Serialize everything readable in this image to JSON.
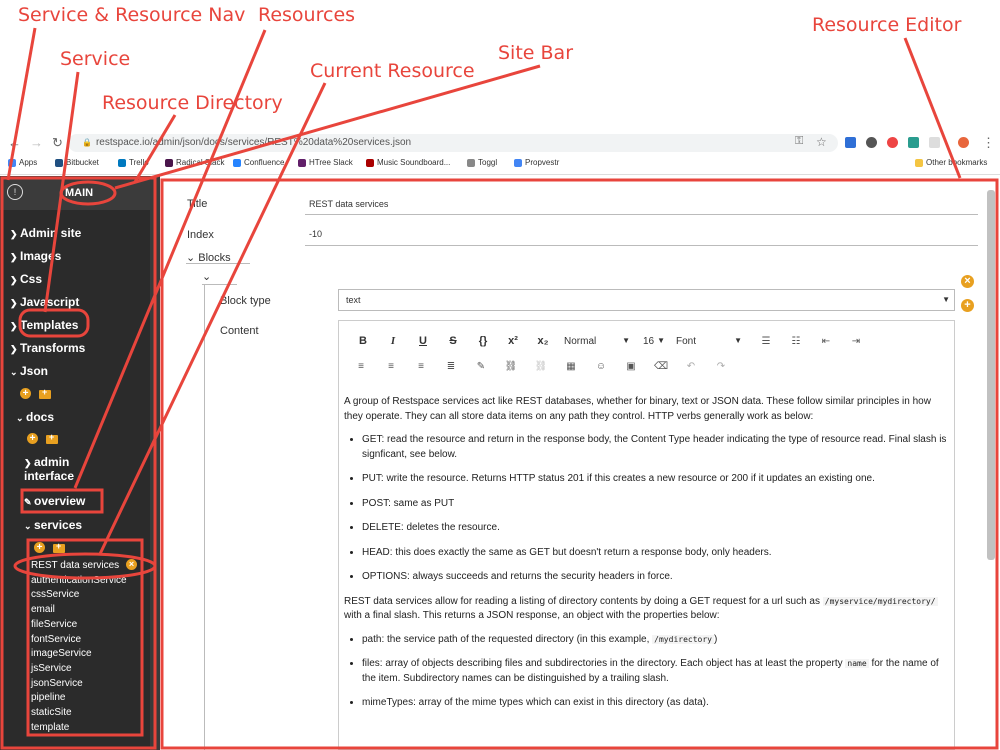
{
  "annotations": {
    "service_resource_nav": "Service & Resource Nav",
    "resources": "Resources",
    "service": "Service",
    "site_bar": "Site Bar",
    "current_resource": "Current Resource",
    "resource_directory": "Resource Directory",
    "resource_editor": "Resource Editor",
    "color": "#e8453c"
  },
  "browser": {
    "url": "restspace.io/admin/json/docs/services/REST%20data%20services.json",
    "bookmarks": [
      {
        "label": "Apps",
        "color": "#4285f4"
      },
      {
        "label": "Bitbucket",
        "color": "#205081"
      },
      {
        "label": "Trello",
        "color": "#0079bf"
      },
      {
        "label": "Radical Slack",
        "color": "#4a154b"
      },
      {
        "label": "Confluence",
        "color": "#2684ff"
      },
      {
        "label": "HTree Slack",
        "color": "#611f69"
      },
      {
        "label": "Music Soundboard...",
        "color": "#a00"
      },
      {
        "label": "Toggl",
        "color": "#888"
      },
      {
        "label": "Propvestr",
        "color": "#4285f4"
      }
    ],
    "other_bookmarks": "Other bookmarks"
  },
  "sidebar": {
    "site_name": "MAIN",
    "services": [
      "Admin site",
      "Images",
      "Css",
      "Javascript",
      "Templates",
      "Transforms",
      "Json"
    ],
    "json_folder": "docs",
    "docs_children": [
      "admin interface",
      "overview",
      "services"
    ],
    "services_files": [
      "REST data services",
      "authenticationService",
      "cssService",
      "email",
      "fileService",
      "fontService",
      "imageService",
      "jsService",
      "jsonService",
      "pipeline",
      "staticSite",
      "template"
    ]
  },
  "editor": {
    "title_label": "Title",
    "title_value": "REST data services",
    "index_label": "Index",
    "index_value": "-10",
    "blocks_label": "Blocks",
    "block_type_label": "Block type",
    "block_type_value": "text",
    "content_label": "Content",
    "toolbar": {
      "bold": "B",
      "italic": "I",
      "underline": "U",
      "strike": "S",
      "code": "{}",
      "superscript": "x²",
      "subscript": "x₂",
      "heading": "Normal",
      "size": "16",
      "font": "Font"
    }
  },
  "content": {
    "intro": "A group of Restspace services act like REST databases, whether for binary, text or JSON data. These follow similar principles in how they operate. They can all store data items on any path they control. HTTP verbs generally work as below:",
    "verbs": [
      "GET: read the resource and return in the response body, the Content Type header indicating the type of resource read. Final slash is signficant, see below.",
      "PUT: write the resource. Returns HTTP status 201 if this creates a new resource or 200 if it updates an existing one.",
      "POST: same as PUT",
      "DELETE: deletes the resource.",
      "HEAD: this does exactly the same as GET but doesn't return a response body, only headers.",
      "OPTIONS: always succeeds and returns the security headers in force."
    ],
    "dir_para_a": "REST data services allow for reading a listing of directory contents by doing a GET request for a url such as",
    "dir_code": "/myservice/mydirectory/",
    "dir_para_b": "with a final slash. This returns a JSON response, an object with the properties below:",
    "path_a": "path: the service path of the requested directory (in this example,",
    "path_code": "/mydirectory",
    "path_b": ")",
    "files_a": "files: array of objects describing files and subdirectories in the directory. Each object has at least the property",
    "files_code": "name",
    "files_b": "for the name of the item. Subdirectory names can be distinguished by a trailing slash.",
    "mime": "mimeTypes: array of the mime types which can exist in this directory (as data)."
  }
}
